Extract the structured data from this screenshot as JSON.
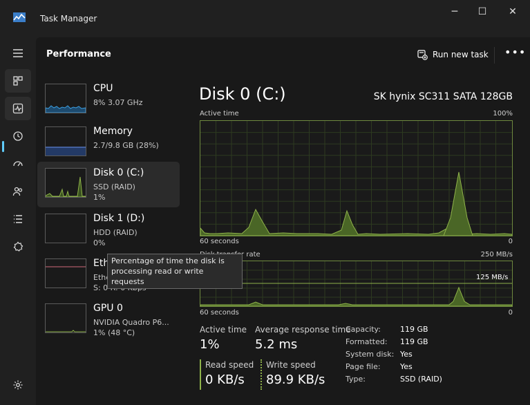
{
  "window": {
    "title": "Task Manager",
    "controls": {
      "minimize": "─",
      "maximize": "☐",
      "close": "✕"
    }
  },
  "header": {
    "title": "Performance",
    "run_new_task": "Run new task",
    "more": "•••"
  },
  "nav": [
    "hamburger-icon",
    "processes-icon",
    "performance-icon",
    "history-icon",
    "startup-icon",
    "users-icon",
    "details-icon",
    "services-icon",
    "settings-icon"
  ],
  "devices": [
    {
      "name": "CPU",
      "line1": "8%  3.07 GHz",
      "line2": ""
    },
    {
      "name": "Memory",
      "line1": "2.7/9.8 GB (28%)",
      "line2": ""
    },
    {
      "name": "Disk 0 (C:)",
      "line1": "SSD (RAID)",
      "line2": "1%"
    },
    {
      "name": "Disk 1 (D:)",
      "line1": "HDD (RAID)",
      "line2": "0%"
    },
    {
      "name": "Ethernet",
      "line1": "Ethernet",
      "line2": "S: 0  R: 0 Kbps"
    },
    {
      "name": "GPU 0",
      "line1": "NVIDIA Quadro P6...",
      "line2": "1% (48 °C)"
    }
  ],
  "tooltip": "Percentage of time the disk is processing read or write requests",
  "detail": {
    "title": "Disk 0 (C:)",
    "model": "SK hynix SC311 SATA 128GB",
    "active_time_graph": {
      "label": "Active time",
      "max": "100%",
      "xlabel": "60 seconds",
      "min": "0"
    },
    "transfer_graph": {
      "label": "Disk transfer rate",
      "max": "250 MB/s",
      "mid": "125 MB/s",
      "xlabel": "60 seconds",
      "min": "0"
    },
    "stats": {
      "active_time_label": "Active time",
      "active_time_value": "1%",
      "avg_response_label": "Average response time",
      "avg_response_value": "5.2 ms",
      "read_speed_label": "Read speed",
      "read_speed_value": "0 KB/s",
      "write_speed_label": "Write speed",
      "write_speed_value": "89.9 KB/s"
    },
    "properties": [
      {
        "key": "Capacity:",
        "value": "119 GB"
      },
      {
        "key": "Formatted:",
        "value": "119 GB"
      },
      {
        "key": "System disk:",
        "value": "Yes"
      },
      {
        "key": "Page file:",
        "value": "Yes"
      },
      {
        "key": "Type:",
        "value": "SSD (RAID)"
      }
    ]
  },
  "colors": {
    "accent": "#60cdff",
    "disk_line": "#8fb34a",
    "disk_fill": "#4a6626",
    "cpu_line": "#3c9dde",
    "memory_line": "#5a7fd1",
    "ethernet_line": "#d06a7a"
  }
}
